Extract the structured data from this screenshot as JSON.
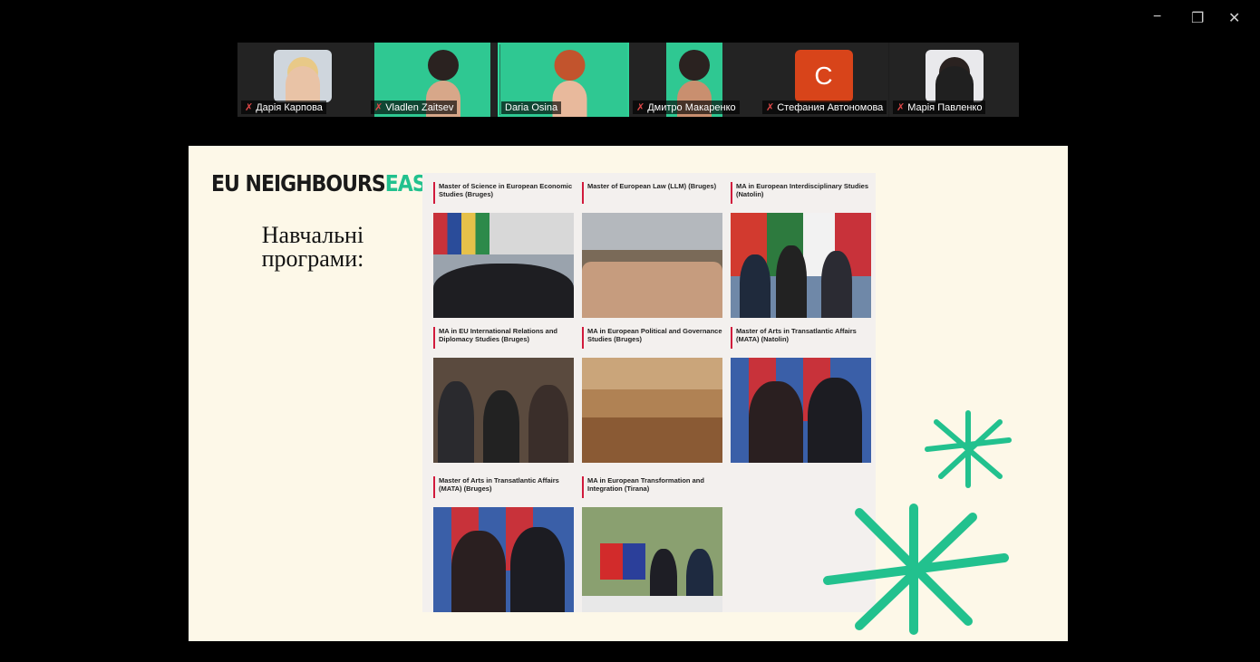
{
  "window": {
    "minimize": "−",
    "restore": "❐",
    "close": "✕"
  },
  "participants": [
    {
      "name": "Дарія Карпова",
      "muted": true,
      "style": "photo"
    },
    {
      "name": "Vladlen Zaitsev",
      "muted": true,
      "style": "green"
    },
    {
      "name": "Daria Osina",
      "muted": false,
      "style": "green",
      "speaking": true
    },
    {
      "name": "Дмитро Макаренко",
      "muted": true,
      "style": "green-small"
    },
    {
      "name": "Стефания Автономова",
      "muted": true,
      "style": "initial",
      "initial": "C"
    },
    {
      "name": "Марія Павленко",
      "muted": true,
      "style": "photo"
    }
  ],
  "slide": {
    "logo_part1": "EU NEIGHBOURS",
    "logo_part2": "EAST",
    "heading_line1": "Навчальні",
    "heading_line2": "програми:",
    "programs": [
      {
        "title": "Master of Science in European Economic Studies (Bruges)"
      },
      {
        "title": "Master of European Law (LLM) (Bruges)"
      },
      {
        "title": "MA in European Interdisciplinary Studies (Natolin)"
      },
      {
        "title": "MA in EU International Relations and Diplomacy Studies (Bruges)"
      },
      {
        "title": "MA in European Political and Governance Studies (Bruges)"
      },
      {
        "title": "Master of Arts in Transatlantic Affairs (MATA) (Natolin)"
      },
      {
        "title": "Master of Arts in Transatlantic Affairs (MATA) (Bruges)"
      },
      {
        "title": "MA in European Transformation and Integration (Tirana)"
      }
    ]
  },
  "colors": {
    "accent_green": "#22c18e",
    "speaker_border": "#2ed79b",
    "title_bar_red": "#d11a3c",
    "slide_bg": "#fdf8e8"
  }
}
